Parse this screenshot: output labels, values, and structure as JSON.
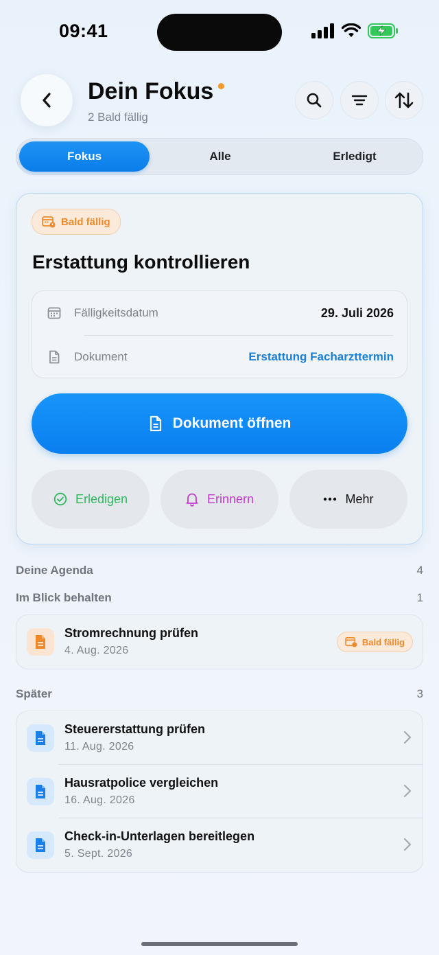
{
  "status_bar": {
    "time": "09:41"
  },
  "header": {
    "title": "Dein Fokus",
    "subtitle": "2 Bald fällig"
  },
  "tabs": [
    {
      "label": "Fokus",
      "active": true
    },
    {
      "label": "Alle",
      "active": false
    },
    {
      "label": "Erledigt",
      "active": false
    }
  ],
  "focus_card": {
    "badge": "Bald fällig",
    "title": "Erstattung kontrollieren",
    "due_label": "Fälligkeitsdatum",
    "due_value": "29. Juli 2026",
    "document_label": "Dokument",
    "document_value": "Erstattung Facharzttermin",
    "primary_button": "Dokument öffnen",
    "actions": {
      "done": "Erledigen",
      "remind": "Erinnern",
      "more": "Mehr"
    }
  },
  "agenda": {
    "title": "Deine Agenda",
    "count": "4",
    "watch": {
      "title": "Im Blick behalten",
      "count": "1",
      "items": [
        {
          "name": "Stromrechnung prüfen",
          "date": "4. Aug. 2026",
          "badge": "Bald fällig"
        }
      ]
    },
    "later": {
      "title": "Später",
      "count": "3",
      "items": [
        {
          "name": "Steuererstattung prüfen",
          "date": "11. Aug. 2026"
        },
        {
          "name": "Hausratpolice vergleichen",
          "date": "16. Aug. 2026"
        },
        {
          "name": "Check-in-Unterlagen bereitlegen",
          "date": "5. Sept. 2026"
        }
      ]
    }
  },
  "colors": {
    "accent": "#0A7FF0",
    "warning": "#EF8A2A",
    "success": "#2EB85C",
    "remind": "#C13BC9",
    "link": "#1A7FD6"
  },
  "icons": {
    "back": "chevron-left-icon",
    "search": "search-icon",
    "filter": "filter-lines-icon",
    "sort": "sort-arrows-icon",
    "calendar": "calendar-icon",
    "document": "document-icon",
    "check": "check-circle-icon",
    "bell": "bell-icon",
    "more": "ellipsis-icon",
    "chevron": "chevron-right-icon"
  }
}
